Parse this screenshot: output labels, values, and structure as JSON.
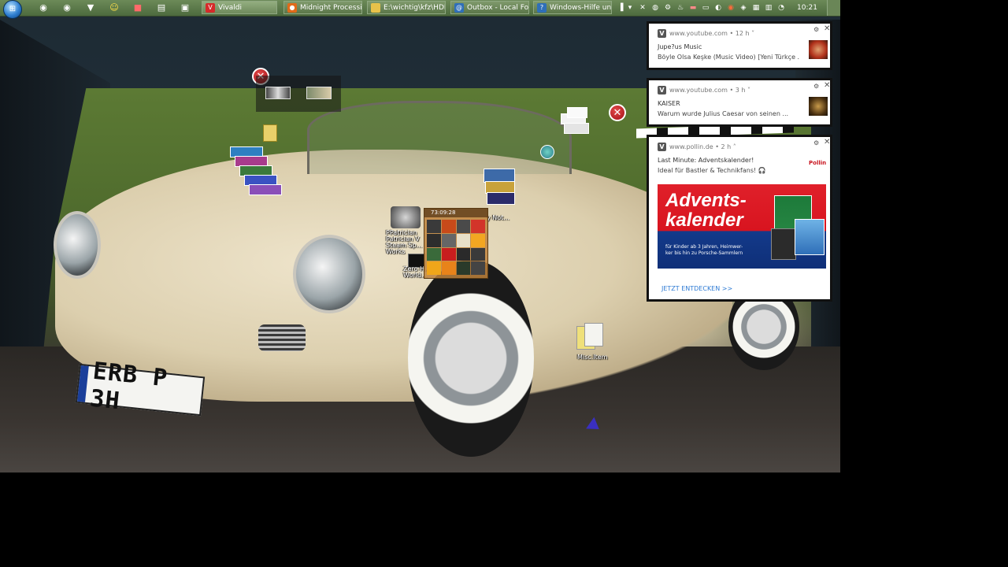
{
  "taskbar": {
    "start_label": "Start",
    "buttons": [
      {
        "label": "Vivaldi",
        "icon": "vivaldi-icon",
        "color": "#d62a2a"
      },
      {
        "label": "Midnight Processio...",
        "icon": "browser-icon",
        "color": "#e06a1a"
      },
      {
        "label": "E:\\wichtig\\kfz\\HDI ...",
        "icon": "folder-icon",
        "color": "#e8c24a"
      },
      {
        "label": "Outbox - Local Fold...",
        "icon": "mail-icon",
        "color": "#2f6fb8"
      },
      {
        "label": "Windows-Hilfe und ...",
        "icon": "help-icon",
        "color": "#2f6fb8"
      }
    ],
    "clock": "10:21"
  },
  "notifications": [
    {
      "site": "www.youtube.com",
      "age": "• 12 h ˅",
      "title": "Jupe?us Music",
      "body": "Böyle Olsa Keşke (Music Video) [Yeni Türkçe ..."
    },
    {
      "site": "www.youtube.com",
      "age": "• 3 h ˅",
      "title": "KAISER",
      "body": "Warum wurde Julius Caesar von seinen ..."
    },
    {
      "site": "www.pollin.de",
      "age": "• 2 h ˄",
      "title": "Last Minute: Adventskalender!",
      "body": "Ideal für Bastler & Technikfans! 🎧",
      "logo": "Pollin",
      "ad_title": "Advents-\nkalender",
      "ad_sub": "für Kinder ab 3 Jahren, Heimwer-\nker bis hin zu Porsche-Sammlern",
      "cta": "JETZT ENTDECKEN >>"
    }
  ],
  "desktop": {
    "plate": "ERB P 3H",
    "clock_widget_time": "73:09:28",
    "labels": {
      "patrician": "PPatrician\nPatrician V\nSteam Sp...\nWorks",
      "zero": "Zero H...\nWorld...",
      "notes": "y Not...",
      "misc": "Misc.Item"
    }
  }
}
